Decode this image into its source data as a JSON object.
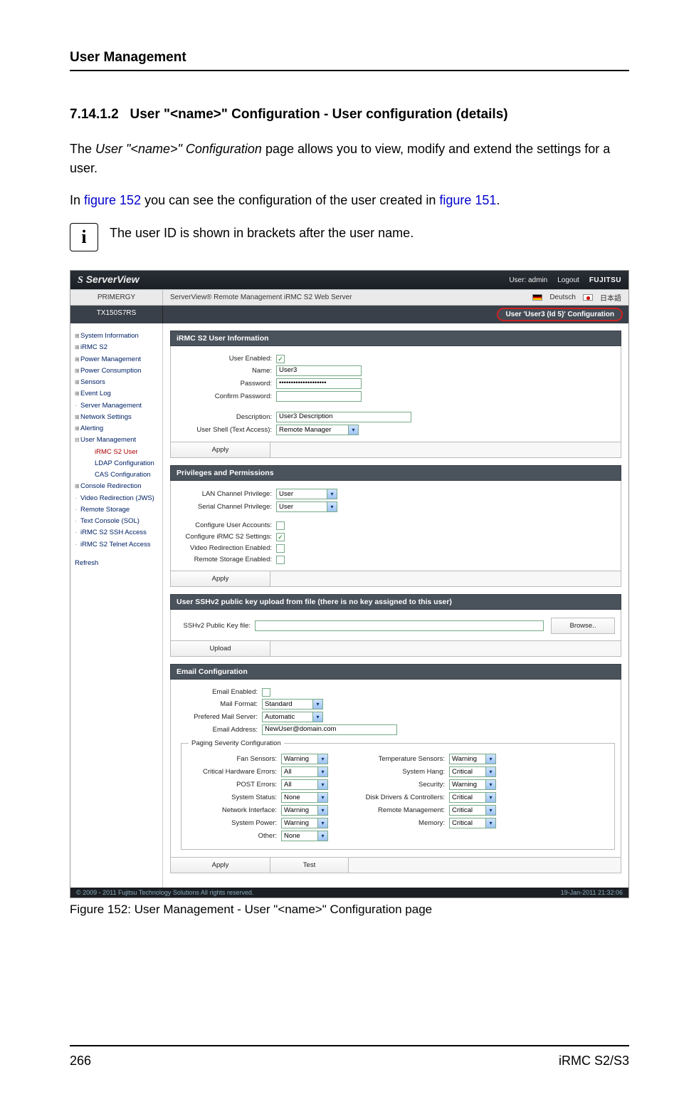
{
  "page": {
    "running_head": "User Management",
    "section_number": "7.14.1.2",
    "section_title": "User \"<name>\" Configuration - User configuration (details)",
    "para1_a": "The ",
    "para1_ital": "User \"<name>\" Configuration",
    "para1_b": " page allows you to view, modify and extend the settings for a user.",
    "para2_a": "In ",
    "para2_link1": "figure 152",
    "para2_b": " you can see the configuration of the user created in ",
    "para2_link2": "figure 151",
    "para2_c": ".",
    "info_text": "The user ID is shown in brackets after the user name.",
    "figure_caption": "Figure 152: User Management - User \"<name>\" Configuration page",
    "page_number": "266",
    "product": "iRMC S2/S3"
  },
  "shot": {
    "titlebar": {
      "logo": "ServerView",
      "user_label": "User: admin",
      "logout": "Logout",
      "brand": "FUJITSU"
    },
    "bar2": {
      "left": "PRIMERGY",
      "mid": "ServerView® Remote Management iRMC S2 Web Server",
      "lang1": "Deutsch",
      "lang2": "日本語"
    },
    "bar3": {
      "left": "TX150S7RS",
      "pill": "User 'User3 (Id 5)' Configuration"
    },
    "nav": {
      "items": [
        {
          "icon": "⊞",
          "label": "System Information"
        },
        {
          "icon": "⊞",
          "label": "iRMC S2"
        },
        {
          "icon": "⊞",
          "label": "Power Management"
        },
        {
          "icon": "⊞",
          "label": "Power Consumption"
        },
        {
          "icon": "⊞",
          "label": "Sensors"
        },
        {
          "icon": "⊞",
          "label": "Event Log"
        },
        {
          "icon": "·",
          "label": "Server Management"
        },
        {
          "icon": "⊞",
          "label": "Network Settings"
        },
        {
          "icon": "⊞",
          "label": "Alerting"
        },
        {
          "icon": "⊟",
          "label": "User Management"
        }
      ],
      "children": [
        {
          "label": "iRMC S2 User",
          "sel": true
        },
        {
          "label": "LDAP Configuration"
        },
        {
          "label": "CAS Configuration"
        }
      ],
      "items2": [
        {
          "icon": "⊞",
          "label": "Console Redirection"
        },
        {
          "icon": "·",
          "label": "Video Redirection (JWS)"
        },
        {
          "icon": "·",
          "label": "Remote Storage"
        },
        {
          "icon": "·",
          "label": "Text Console (SOL)"
        },
        {
          "icon": "·",
          "label": "iRMC S2 SSH Access"
        },
        {
          "icon": "·",
          "label": "iRMC S2 Telnet Access"
        }
      ],
      "refresh": "Refresh"
    },
    "panel_user_info": {
      "head": "iRMC S2 User Information",
      "user_enabled_label": "User Enabled:",
      "name_label": "Name:",
      "name_value": "User3",
      "password_label": "Password:",
      "password_value": "••••••••••••••••••••",
      "confirm_label": "Confirm Password:",
      "description_label": "Description:",
      "description_value": "User3 Description",
      "shell_label": "User Shell (Text Access):",
      "shell_value": "Remote Manager",
      "apply": "Apply"
    },
    "panel_priv": {
      "head": "Privileges and Permissions",
      "lan_label": "LAN Channel Privilege:",
      "lan_value": "User",
      "serial_label": "Serial Channel Privilege:",
      "serial_value": "User",
      "cua_label": "Configure User Accounts:",
      "cirmc_label": "Configure iRMC S2 Settings:",
      "vre_label": "Video Redirection Enabled:",
      "rse_label": "Remote Storage Enabled:",
      "apply": "Apply"
    },
    "panel_ssh": {
      "head": "User SSHv2 public key upload from file (there is no key assigned to this user)",
      "file_label": "SSHv2 Public Key file:",
      "browse": "Browse..",
      "upload": "Upload"
    },
    "panel_email": {
      "head": "Email Configuration",
      "enabled_label": "Email Enabled:",
      "format_label": "Mail Format:",
      "format_value": "Standard",
      "server_label": "Prefered Mail Server:",
      "server_value": "Automatic",
      "email_label": "Email Address:",
      "email_value": "NewUser@domain.com",
      "fieldset_legend": "Paging Severity Configuration",
      "left": [
        {
          "label": "Fan Sensors:",
          "value": "Warning"
        },
        {
          "label": "Critical Hardware Errors:",
          "value": "All"
        },
        {
          "label": "POST Errors:",
          "value": "All"
        },
        {
          "label": "System Status:",
          "value": "None"
        },
        {
          "label": "Network Interface:",
          "value": "Warning"
        },
        {
          "label": "System Power:",
          "value": "Warning"
        },
        {
          "label": "Other:",
          "value": "None"
        }
      ],
      "right": [
        {
          "label": "Temperature Sensors:",
          "value": "Warning"
        },
        {
          "label": "System Hang:",
          "value": "Critical"
        },
        {
          "label": "Security:",
          "value": "Warning"
        },
        {
          "label": "Disk Drivers & Controllers:",
          "value": "Critical"
        },
        {
          "label": "Remote Management:",
          "value": "Critical"
        },
        {
          "label": "Memory:",
          "value": "Critical"
        }
      ],
      "apply": "Apply",
      "test": "Test"
    },
    "copyright": {
      "left": "© 2009 - 2011 Fujitsu Technology Solutions All rights reserved.",
      "right": "19-Jan-2011 21:32:06"
    }
  }
}
